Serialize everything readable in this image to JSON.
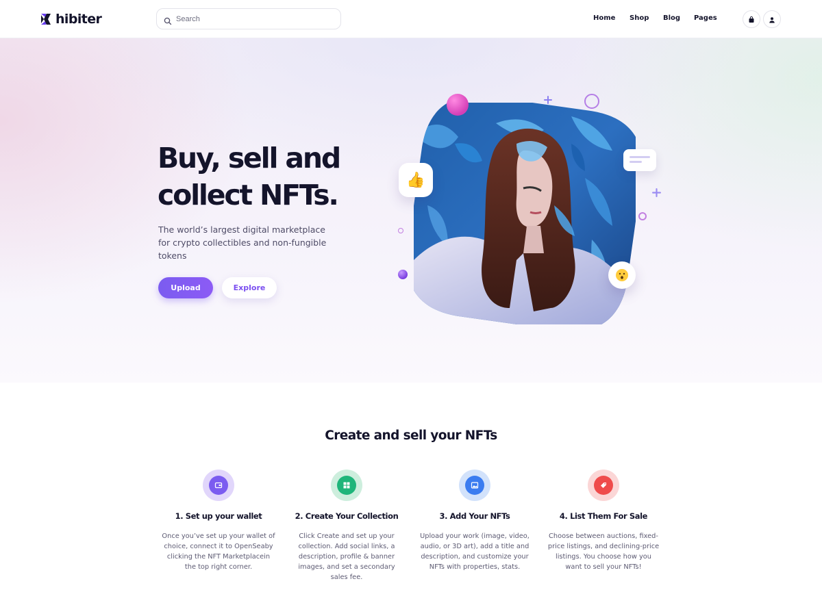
{
  "header": {
    "logo_text": "hibiter",
    "search_placeholder": "Search",
    "nav": [
      {
        "label": "Home"
      },
      {
        "label": "Shop"
      },
      {
        "label": "Blog"
      },
      {
        "label": "Pages"
      }
    ],
    "icons": [
      "cart-icon",
      "user-icon"
    ]
  },
  "hero": {
    "title_line1": "Buy, sell and",
    "title_line2": "collect NFTs.",
    "subtitle": "The world’s largest digital marketplace for crypto collectibles and non-fungible tokens",
    "upload_label": "Upload",
    "explore_label": "Explore",
    "accent_color": "#7b5cf0"
  },
  "steps_section": {
    "title": "Create and sell your NFTs",
    "steps": [
      {
        "title": "1. Set up your wallet",
        "description": "Once you’ve set up your wallet of choice, connect it to OpenSeaby clicking the NFT Marketplacein the top right corner.",
        "icon": "wallet-icon",
        "color": "#7b5cf0"
      },
      {
        "title": "2. Create Your Collection",
        "description": "Click Create and set up your collection. Add social links, a description, profile & banner images, and set a secondary sales fee.",
        "icon": "grid-icon",
        "color": "#1fb57a"
      },
      {
        "title": "3. Add Your NFTs",
        "description": "Upload your work (image, video, audio, or 3D art), add a title and description, and customize your NFTs with properties, stats.",
        "icon": "image-icon",
        "color": "#3b7cf0"
      },
      {
        "title": "4. List Them For Sale",
        "description": "Choose between auctions, fixed-price listings, and declining-price listings. You choose how you want to sell your NFTs!",
        "icon": "tag-icon",
        "color": "#ef4b4b"
      }
    ]
  }
}
